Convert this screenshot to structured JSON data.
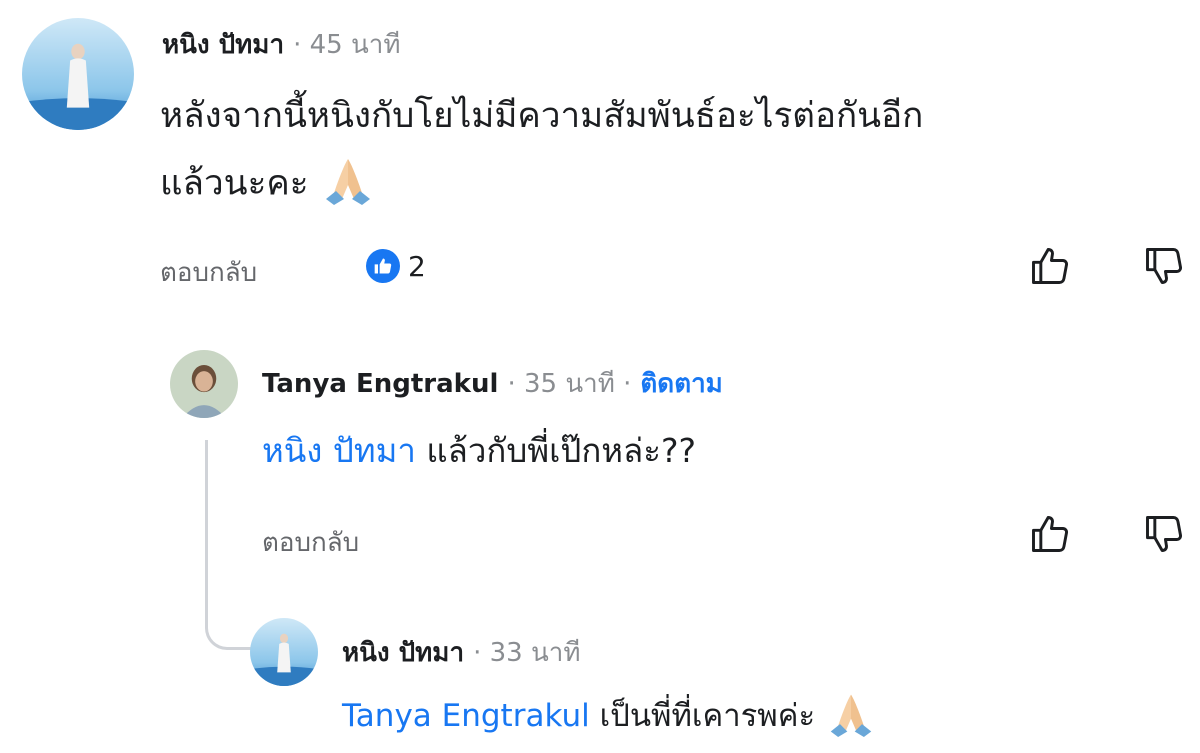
{
  "comments": [
    {
      "author": "หนิง ปัทมา",
      "time": "· 45 นาที",
      "text_line1": "หลังจากนี้หนิงกับโยไม่มีความสัมพันธ์อะไรต่อกันอีก",
      "text_line2": "แล้วนะคะ",
      "text_emoji": "folded-hands-emoji",
      "reply_label": "ตอบกลับ",
      "reaction_icon": "like-reaction-icon",
      "reaction_count": "2"
    },
    {
      "author": "Tanya Engtrakul",
      "time": "· 35 นาที ·",
      "follow_label": "ติดตาม",
      "mention": "หนิง ปัทมา",
      "text": " แล้วกับพี่เป๊กหล่ะ??",
      "reply_label": "ตอบกลับ"
    },
    {
      "author": "หนิง ปัทมา",
      "time": "· 33 นาที",
      "mention": "Tanya Engtrakul",
      "text": " เป็นพี่ที่เคารพค่ะ",
      "text_emoji": "folded-hands-emoji"
    }
  ],
  "icons": {
    "upvote": "thumbs-up-outline-icon",
    "downvote": "thumbs-down-outline-icon"
  },
  "colors": {
    "accent": "#1877f2",
    "meta": "#8a8d91",
    "text": "#1c1e21"
  }
}
